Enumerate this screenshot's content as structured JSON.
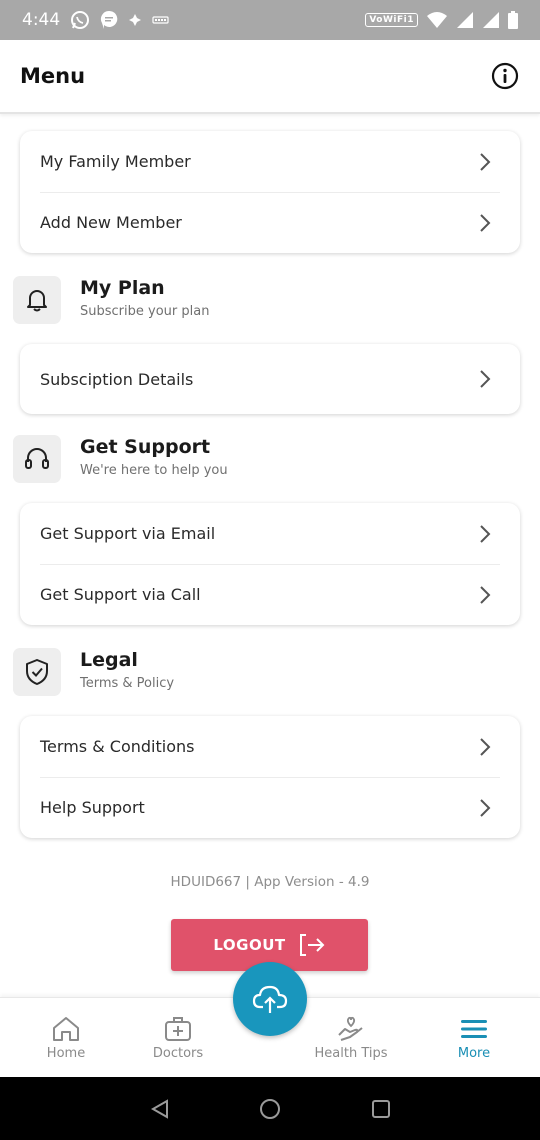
{
  "status_bar": {
    "time": "4:44",
    "wifi_badge": "VoWiFi1"
  },
  "header": {
    "title": "Menu"
  },
  "family_card": {
    "items": [
      {
        "label": "My Family Member"
      },
      {
        "label": "Add New Member"
      }
    ]
  },
  "plan_section": {
    "title": "My Plan",
    "subtitle": "Subscribe your plan"
  },
  "plan_card": {
    "items": [
      {
        "label": "Subsciption Details"
      }
    ]
  },
  "support_section": {
    "title": "Get Support",
    "subtitle": "We're here to help you"
  },
  "support_card": {
    "items": [
      {
        "label": "Get Support via Email"
      },
      {
        "label": "Get Support via Call"
      }
    ]
  },
  "legal_section": {
    "title": "Legal",
    "subtitle": "Terms & Policy"
  },
  "legal_card": {
    "items": [
      {
        "label": "Terms & Conditions"
      },
      {
        "label": "Help Support"
      }
    ]
  },
  "version": "HDUID667 |  App Version - 4.9",
  "logout": {
    "label": "LOGOUT"
  },
  "bottom_nav": {
    "items": [
      {
        "label": "Home",
        "icon": "home-icon"
      },
      {
        "label": "Doctors",
        "icon": "medical-kit-icon"
      },
      {
        "label": "Health Tips",
        "icon": "hand-heart-icon"
      },
      {
        "label": "More",
        "icon": "menu-icon",
        "active": true
      }
    ],
    "fab_icon": "cloud-upload-icon"
  },
  "colors": {
    "accent": "#1996bd",
    "logout": "#e0526a",
    "active_nav": "#1a8fb5"
  }
}
